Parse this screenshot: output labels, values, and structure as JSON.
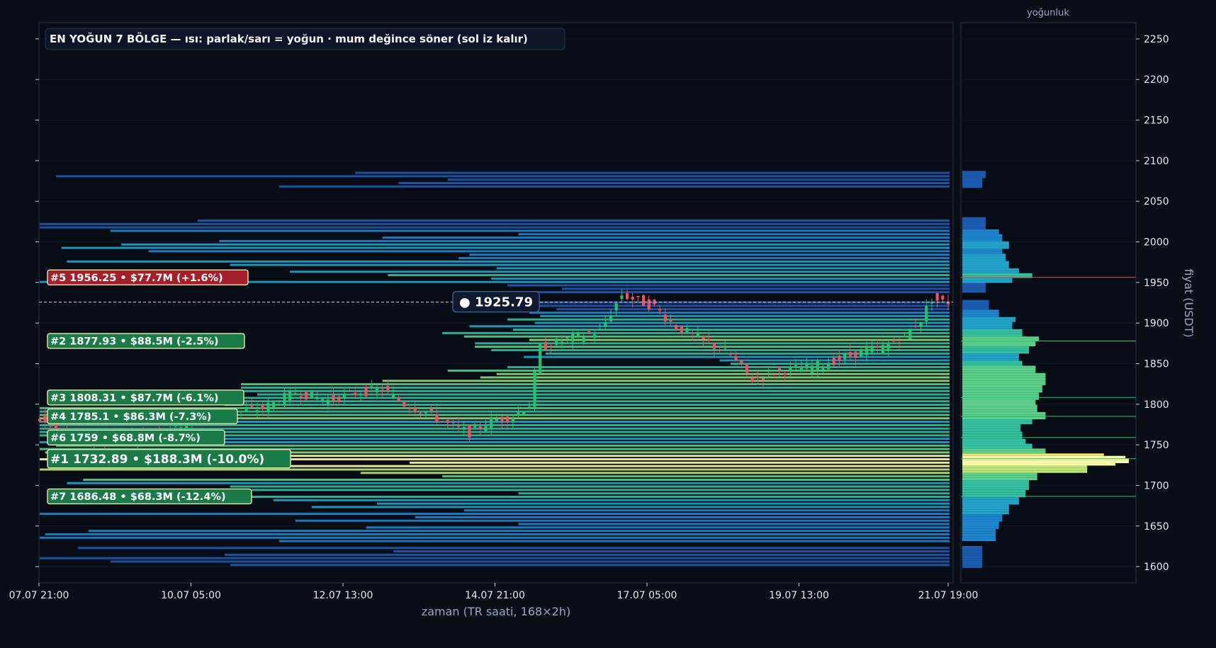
{
  "chart_data": {
    "type": "candlestick-heatmap",
    "title": "EN YOĞUN 7 BÖLGE — ısı: parlak/sarı = yoğun · mum değince söner (sol iz kalır)",
    "xlabel": "zaman (TR saati, 168×2h)",
    "ylabel": "fiyat (USDT)",
    "profile_title": "yoğunluk",
    "ylim": [
      1580,
      2270
    ],
    "y_ticks": [
      1600,
      1650,
      1700,
      1750,
      1800,
      1850,
      1900,
      1950,
      2000,
      2050,
      2100,
      2150,
      2200,
      2250
    ],
    "x_ticks": [
      "07.07 21:00",
      "10.07 05:00",
      "12.07 13:00",
      "14.07 21:00",
      "17.07 05:00",
      "19.07 13:00",
      "21.07 19:00"
    ],
    "candle_count": 168,
    "current_price": {
      "value": 1925.79,
      "label": "● 1925.79"
    },
    "zones": [
      {
        "rank": 1,
        "price": 1732.89,
        "label": "#1  1732.89  •  $188.3M  (-10.0%)",
        "color": "#1a7a48",
        "primary": true
      },
      {
        "rank": 2,
        "price": 1877.93,
        "label": "#2  1877.93  •  $88.5M  (-2.5%)",
        "color": "#1a7a48"
      },
      {
        "rank": 3,
        "price": 1808.31,
        "label": "#3  1808.31  •  $87.7M  (-6.1%)",
        "color": "#1a7a48"
      },
      {
        "rank": 4,
        "price": 1785.1,
        "label": "#4  1785.1  •  $86.3M  (-7.3%)",
        "color": "#1a7a48"
      },
      {
        "rank": 5,
        "price": 1956.25,
        "label": "#5  1956.25  •  $77.7M  (+1.6%)",
        "color": "#a51f2b"
      },
      {
        "rank": 6,
        "price": 1759,
        "label": "#6  1759  •  $68.8M  (-8.7%)",
        "color": "#1a7a48"
      },
      {
        "rank": 7,
        "price": 1686.48,
        "label": "#7  1686.48  •  $68.3M  (-12.4%)",
        "color": "#1a7a48"
      }
    ],
    "profile": [
      {
        "p": 1605,
        "v": 0.12
      },
      {
        "p": 1615,
        "v": 0.12
      },
      {
        "p": 1640,
        "v": 0.2
      },
      {
        "p": 1650,
        "v": 0.22
      },
      {
        "p": 1660,
        "v": 0.24
      },
      {
        "p": 1670,
        "v": 0.28
      },
      {
        "p": 1680,
        "v": 0.34
      },
      {
        "p": 1690,
        "v": 0.38
      },
      {
        "p": 1700,
        "v": 0.4
      },
      {
        "p": 1710,
        "v": 0.45
      },
      {
        "p": 1720,
        "v": 0.75
      },
      {
        "p": 1726,
        "v": 0.92
      },
      {
        "p": 1730,
        "v": 1.0
      },
      {
        "p": 1734,
        "v": 0.98
      },
      {
        "p": 1738,
        "v": 0.85
      },
      {
        "p": 1742,
        "v": 0.5
      },
      {
        "p": 1748,
        "v": 0.42
      },
      {
        "p": 1755,
        "v": 0.38
      },
      {
        "p": 1762,
        "v": 0.36
      },
      {
        "p": 1770,
        "v": 0.35
      },
      {
        "p": 1778,
        "v": 0.42
      },
      {
        "p": 1786,
        "v": 0.5
      },
      {
        "p": 1794,
        "v": 0.45
      },
      {
        "p": 1802,
        "v": 0.44
      },
      {
        "p": 1810,
        "v": 0.46
      },
      {
        "p": 1818,
        "v": 0.48
      },
      {
        "p": 1826,
        "v": 0.5
      },
      {
        "p": 1834,
        "v": 0.5
      },
      {
        "p": 1842,
        "v": 0.44
      },
      {
        "p": 1850,
        "v": 0.36
      },
      {
        "p": 1858,
        "v": 0.34
      },
      {
        "p": 1866,
        "v": 0.4
      },
      {
        "p": 1874,
        "v": 0.44
      },
      {
        "p": 1880,
        "v": 0.46
      },
      {
        "p": 1888,
        "v": 0.36
      },
      {
        "p": 1896,
        "v": 0.3
      },
      {
        "p": 1904,
        "v": 0.32
      },
      {
        "p": 1912,
        "v": 0.22
      },
      {
        "p": 1918,
        "v": 0.16
      },
      {
        "p": 1946,
        "v": 0.14
      },
      {
        "p": 1952,
        "v": 0.3
      },
      {
        "p": 1958,
        "v": 0.42
      },
      {
        "p": 1964,
        "v": 0.34
      },
      {
        "p": 1972,
        "v": 0.28
      },
      {
        "p": 1980,
        "v": 0.26
      },
      {
        "p": 1988,
        "v": 0.24
      },
      {
        "p": 1996,
        "v": 0.28
      },
      {
        "p": 2004,
        "v": 0.24
      },
      {
        "p": 2012,
        "v": 0.22
      },
      {
        "p": 2020,
        "v": 0.14
      },
      {
        "p": 2076,
        "v": 0.12
      },
      {
        "p": 2080,
        "v": 0.14
      }
    ],
    "candle_path": [
      {
        "i": 0,
        "p": 1785
      },
      {
        "i": 6,
        "p": 1760
      },
      {
        "i": 12,
        "p": 1752
      },
      {
        "i": 18,
        "p": 1760
      },
      {
        "i": 24,
        "p": 1770
      },
      {
        "i": 30,
        "p": 1782
      },
      {
        "i": 36,
        "p": 1790
      },
      {
        "i": 42,
        "p": 1795
      },
      {
        "i": 48,
        "p": 1815
      },
      {
        "i": 54,
        "p": 1805
      },
      {
        "i": 60,
        "p": 1815
      },
      {
        "i": 64,
        "p": 1818
      },
      {
        "i": 68,
        "p": 1800
      },
      {
        "i": 72,
        "p": 1790
      },
      {
        "i": 76,
        "p": 1775
      },
      {
        "i": 80,
        "p": 1765
      },
      {
        "i": 84,
        "p": 1780
      },
      {
        "i": 88,
        "p": 1785
      },
      {
        "i": 91,
        "p": 1800
      },
      {
        "i": 93,
        "p": 1870
      },
      {
        "i": 98,
        "p": 1880
      },
      {
        "i": 104,
        "p": 1890
      },
      {
        "i": 108,
        "p": 1935
      },
      {
        "i": 114,
        "p": 1920
      },
      {
        "i": 118,
        "p": 1895
      },
      {
        "i": 124,
        "p": 1875
      },
      {
        "i": 128,
        "p": 1860
      },
      {
        "i": 132,
        "p": 1830
      },
      {
        "i": 136,
        "p": 1840
      },
      {
        "i": 142,
        "p": 1845
      },
      {
        "i": 148,
        "p": 1855
      },
      {
        "i": 152,
        "p": 1865
      },
      {
        "i": 156,
        "p": 1870
      },
      {
        "i": 160,
        "p": 1885
      },
      {
        "i": 163,
        "p": 1905
      },
      {
        "i": 165,
        "p": 1930
      },
      {
        "i": 167,
        "p": 1926
      }
    ]
  }
}
